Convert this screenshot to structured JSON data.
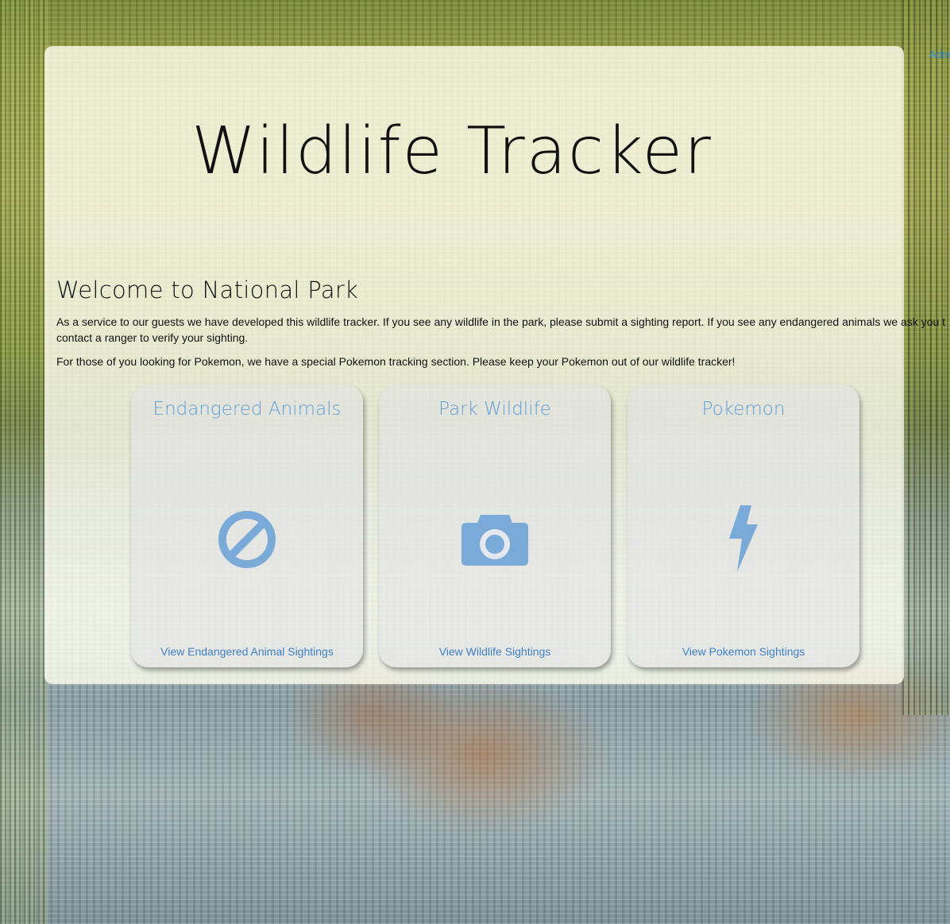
{
  "nav": {
    "admin_label": "Adm"
  },
  "header": {
    "title": "Wildlife Tracker"
  },
  "welcome": {
    "heading": "Welcome to National Park",
    "intro": "As a service to our guests we have developed this wildlife tracker. If you see any wildlife in the park, please submit a sighting report. If you see any endangered animals we ask you t contact a ranger to verify your sighting.",
    "pokemon_note": "For those of you looking for Pokemon, we have a special Pokemon tracking section. Please keep your Pokemon out of our wildlife tracker!"
  },
  "cards": [
    {
      "title": "Endangered Animals",
      "icon": "ban-icon",
      "link_label": "View Endangered Animal Sightings"
    },
    {
      "title": "Park Wildlife",
      "icon": "camera-icon",
      "link_label": "View Wildlife Sightings"
    },
    {
      "title": "Pokemon",
      "icon": "lightning-bolt-icon",
      "link_label": "View Pokemon Sightings"
    }
  ],
  "colors": {
    "accent": "#5f9fd8",
    "icon": "#7aaad8",
    "link": "#3f7fc4"
  }
}
